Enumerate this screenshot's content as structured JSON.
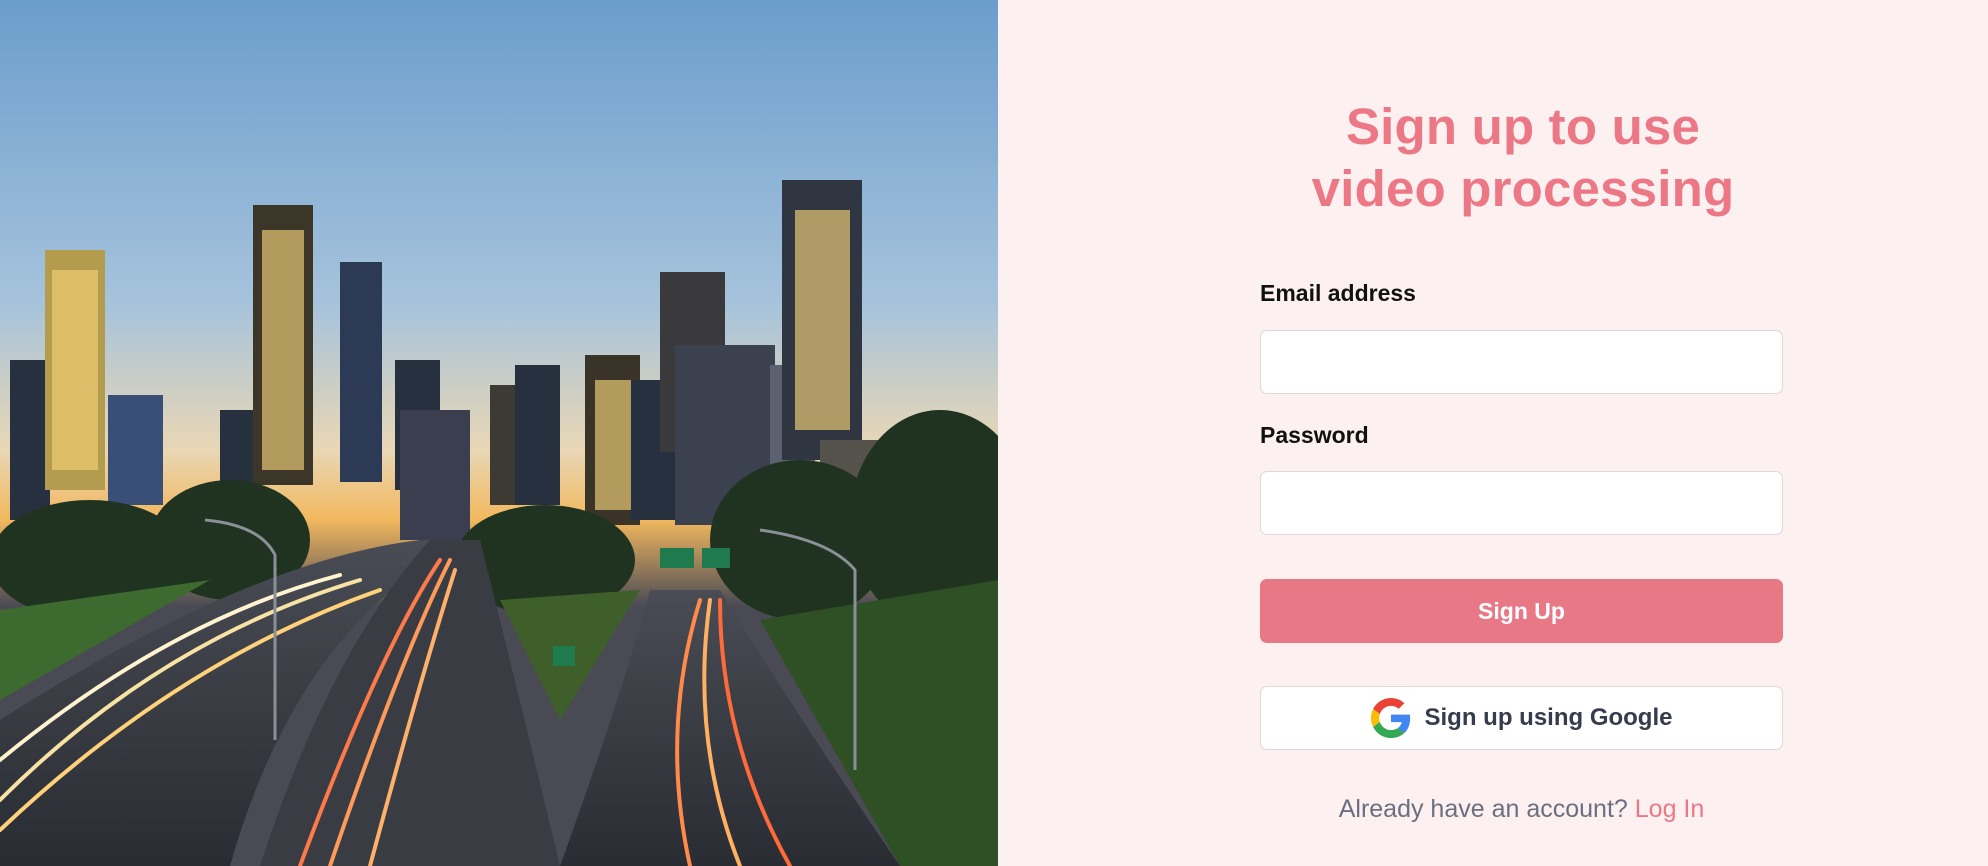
{
  "hero": {
    "image": "city-skyline-highway-photo"
  },
  "signup": {
    "title_line1": "Sign up to use",
    "title_line2": "video processing",
    "email_label": "Email address",
    "email_value": "",
    "password_label": "Password",
    "password_value": "",
    "submit_label": "Sign Up",
    "google_label": "Sign up using Google",
    "google_icon": "google-icon",
    "login_prompt": "Already have an account?",
    "login_link": "Log In"
  },
  "colors": {
    "accent": "#e97886",
    "background": "#fdf0f0",
    "text_dark": "#111111",
    "muted": "#6b6f80"
  }
}
